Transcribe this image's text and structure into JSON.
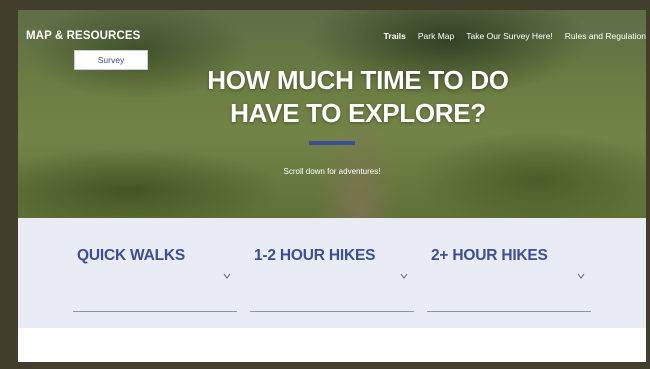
{
  "header": {
    "brand": "MAP & RESOURCES",
    "nav": [
      {
        "label": "Trails",
        "active": true
      },
      {
        "label": "Park Map",
        "active": false
      },
      {
        "label": "Take Our Survey Here!",
        "active": false
      },
      {
        "label": "Rules and Regulation",
        "active": false
      }
    ],
    "survey_button": "Survey"
  },
  "hero": {
    "headline_line1": "HOW MUCH TIME TO DO",
    "headline_line2": "HAVE TO EXPLORE?",
    "scroll_text": "Scroll down for adventures!"
  },
  "categories": [
    {
      "title": "QUICK WALKS",
      "icon": "chevron-down-icon"
    },
    {
      "title": "1-2 HOUR HIKES",
      "icon": "chevron-down-icon"
    },
    {
      "title": "2+ HOUR HIKES",
      "icon": "chevron-down-icon"
    }
  ],
  "colors": {
    "accent": "#3c4e96",
    "panel": "#e9ebf5",
    "frame": "#413e2b"
  }
}
